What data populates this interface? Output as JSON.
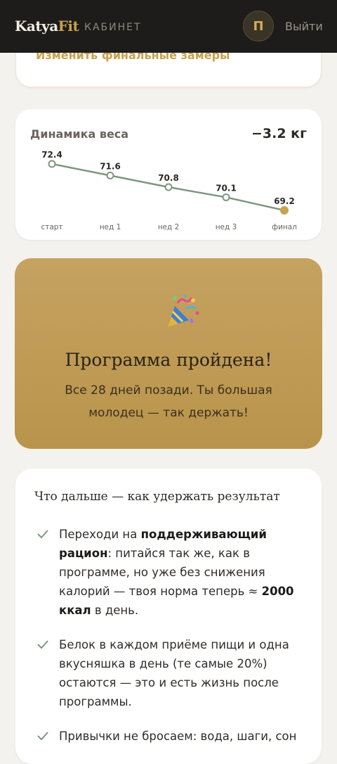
{
  "header": {
    "logo_main": "Katya",
    "logo_accent": "Fit",
    "section": "КАБИНЕТ",
    "avatar_initial": "П",
    "logout_label": "Выйти"
  },
  "measurements": {
    "edit_link": "Изменить финальные замеры"
  },
  "weight_card": {
    "title": "Динамика веса",
    "delta": "−3.2 кг",
    "chart_data": {
      "type": "line",
      "title": "Динамика веса",
      "categories": [
        "старт",
        "нед 1",
        "нед 2",
        "нед 3",
        "финал"
      ],
      "values": [
        72.4,
        71.6,
        70.8,
        70.1,
        69.2
      ],
      "value_labels": [
        "72.4",
        "71.6",
        "70.8",
        "70.1",
        "69.2"
      ],
      "grid": false,
      "colors": {
        "line": "#7c977f",
        "final_point": "#c9a24e"
      }
    }
  },
  "banner": {
    "icon": "party-popper-icon",
    "title": "Программа пройдена!",
    "subtitle": "Все 28 дней позади. Ты большая молодец — так держать!"
  },
  "next": {
    "title": "Что дальше — как удержать результат",
    "tips": [
      {
        "parts": [
          {
            "t": "Переходи на ",
            "b": false
          },
          {
            "t": "поддерживающий рацион",
            "b": true
          },
          {
            "t": ": питайся так же, как в программе, но уже без снижения калорий — твоя норма теперь ≈ ",
            "b": false
          },
          {
            "t": "2000 ккал",
            "b": true
          },
          {
            "t": " в день.",
            "b": false
          }
        ]
      },
      {
        "parts": [
          {
            "t": "Белок в каждом приёме пищи и одна вкусняшка в день (те самые 20%) остаются — это и есть жизнь после программы.",
            "b": false
          }
        ]
      },
      {
        "parts": [
          {
            "t": "Привычки не бросаем: вода, шаги, сон",
            "b": false
          }
        ]
      }
    ]
  },
  "colors": {
    "accent": "#c9a24e",
    "topbar": "#1d1c1a",
    "check": "#7c977f"
  }
}
